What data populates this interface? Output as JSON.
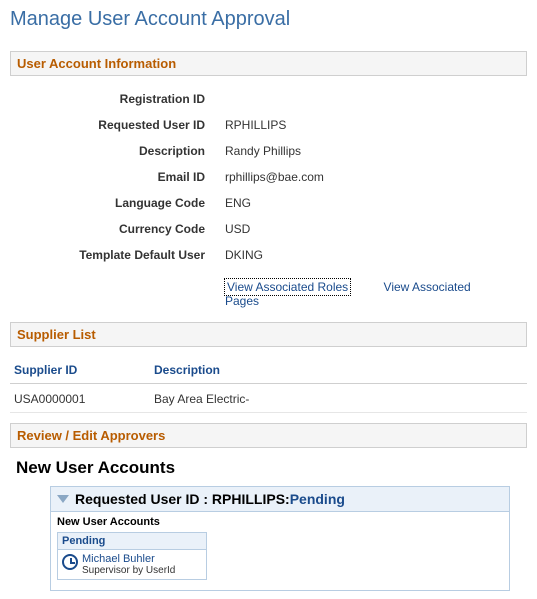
{
  "page_title": "Manage User Account Approval",
  "sections": {
    "user_account_info": {
      "header": "User Account Information",
      "fields": {
        "registration_id": {
          "label": "Registration ID",
          "value": ""
        },
        "requested_user_id": {
          "label": "Requested User ID",
          "value": "RPHILLIPS"
        },
        "description": {
          "label": "Description",
          "value": "Randy Phillips"
        },
        "email_id": {
          "label": "Email ID",
          "value": "rphillips@bae.com"
        },
        "language_code": {
          "label": "Language Code",
          "value": "ENG"
        },
        "currency_code": {
          "label": "Currency Code",
          "value": "USD"
        },
        "template_default_user": {
          "label": "Template Default User",
          "value": "DKING"
        }
      },
      "links": {
        "view_roles": "View Associated Roles",
        "view_pages": "View Associated Pages"
      }
    },
    "supplier_list": {
      "header": "Supplier List",
      "columns": {
        "supplier_id": "Supplier ID",
        "description": "Description"
      },
      "rows": [
        {
          "supplier_id": "USA0000001",
          "description": "Bay Area Electric-"
        }
      ]
    },
    "review_approvers": {
      "header": "Review / Edit Approvers"
    }
  },
  "workflow": {
    "title": "New User Accounts",
    "header_label": "Requested User ID : RPHILLIPS:",
    "header_status": "Pending",
    "subtitle": "New User Accounts",
    "approver": {
      "status": "Pending",
      "name": "Michael Buhler",
      "role": "Supervisor by UserId"
    }
  }
}
